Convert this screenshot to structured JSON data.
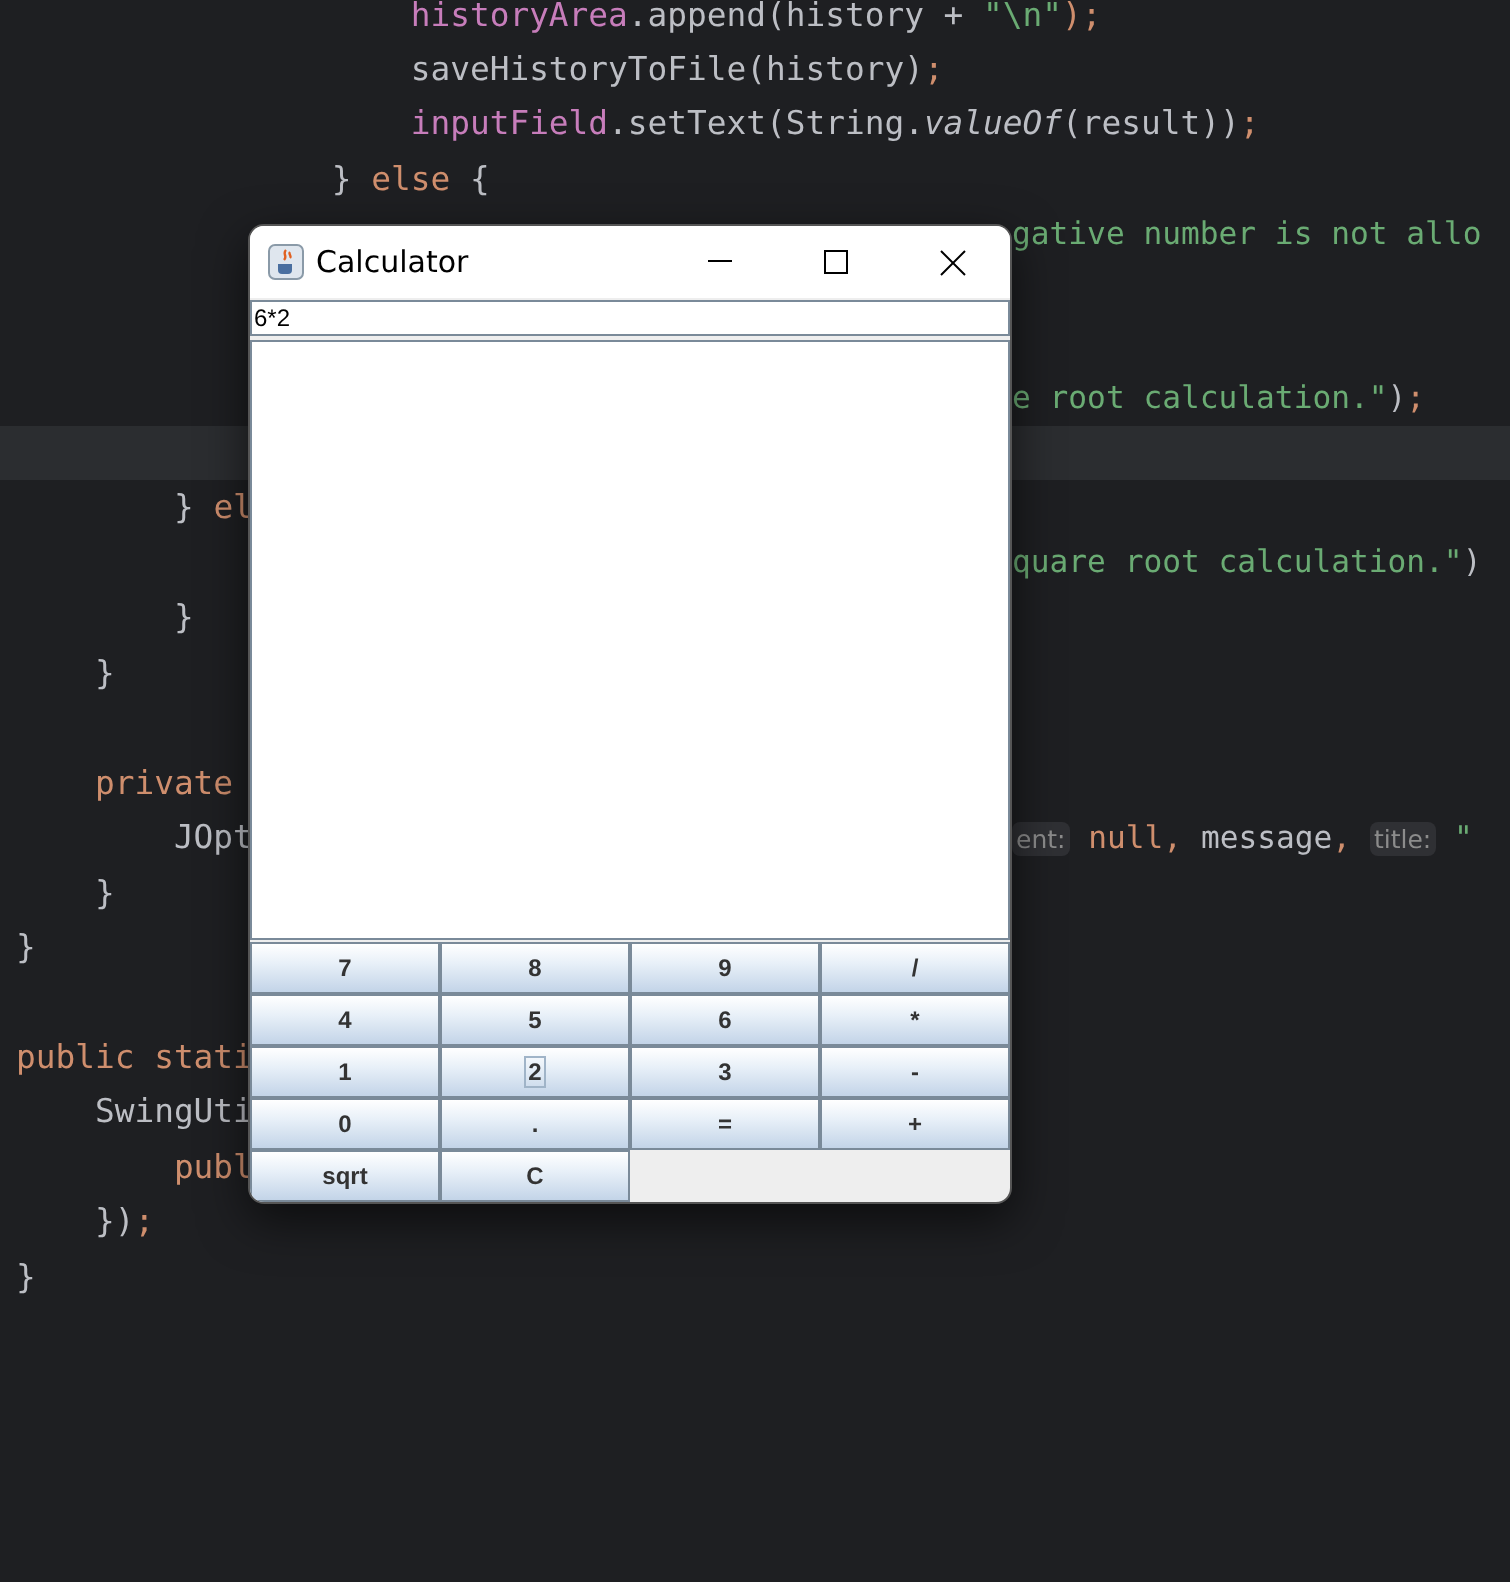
{
  "editor": {
    "lines": [
      {
        "current": false,
        "left": [
          {
            "text": "                    historyArea",
            "kind": "field"
          },
          {
            "text": ".append(history + ",
            "kind": "plain"
          },
          {
            "text": "\"\\n\"",
            "kind": "string"
          },
          {
            "text": ");",
            "kind": "keyword"
          }
        ]
      },
      {
        "current": false,
        "left": [
          {
            "text": "                    saveHistoryToFile(history)",
            "kind": "plain"
          },
          {
            "text": ";",
            "kind": "keyword"
          }
        ]
      },
      {
        "current": false,
        "left": [
          {
            "text": "                    inputField",
            "kind": "field"
          },
          {
            "text": ".setText(String.",
            "kind": "plain"
          },
          {
            "text": "valueOf",
            "kind": "static"
          },
          {
            "text": "(result))",
            "kind": "plain"
          },
          {
            "text": ";",
            "kind": "keyword"
          }
        ]
      },
      {
        "current": false,
        "left": [
          {
            "text": "                } ",
            "kind": "plain"
          },
          {
            "text": "else",
            "kind": "keyword"
          },
          {
            "text": " {",
            "kind": "plain"
          }
        ]
      },
      {
        "current": false,
        "right": [
          {
            "text": "gative number is not allo",
            "kind": "string"
          }
        ]
      },
      {
        "current": false
      },
      {
        "current": false
      },
      {
        "current": false,
        "right": [
          {
            "text": "e root calculation.\"",
            "kind": "string"
          },
          {
            "text": ")",
            "kind": "plain"
          },
          {
            "text": ";",
            "kind": "keyword"
          }
        ]
      },
      {
        "current": true
      },
      {
        "current": false,
        "left": [
          {
            "text": "        } ",
            "kind": "plain"
          },
          {
            "text": "el",
            "kind": "keyword"
          }
        ]
      },
      {
        "current": false,
        "right": [
          {
            "text": "quare root calculation.\"",
            "kind": "string"
          },
          {
            "text": ")",
            "kind": "plain"
          }
        ]
      },
      {
        "current": false,
        "left": [
          {
            "text": "        }",
            "kind": "plain"
          }
        ]
      },
      {
        "current": false,
        "left": [
          {
            "text": "    }",
            "kind": "plain"
          }
        ]
      },
      {
        "current": false
      },
      {
        "current": false,
        "left": [
          {
            "text": "    private",
            "kind": "keyword"
          }
        ]
      },
      {
        "current": false,
        "left": [
          {
            "text": "        JOpt",
            "kind": "plain"
          }
        ],
        "right": [
          {
            "text": "ent:",
            "kind": "hint"
          },
          {
            "text": " null, ",
            "kind": "keyword"
          },
          {
            "text": "message",
            "kind": "plain"
          },
          {
            "text": ", ",
            "kind": "keyword"
          },
          {
            "text": "title:",
            "kind": "hint"
          },
          {
            "text": " \"",
            "kind": "string"
          }
        ]
      },
      {
        "current": false,
        "left": [
          {
            "text": "    }",
            "kind": "plain"
          }
        ]
      },
      {
        "current": false,
        "left": [
          {
            "text": "}",
            "kind": "plain"
          }
        ]
      },
      {
        "current": false
      },
      {
        "current": false,
        "left": [
          {
            "text": "public stati",
            "kind": "keyword"
          }
        ]
      },
      {
        "current": false,
        "left": [
          {
            "text": "    SwingUti",
            "kind": "plain"
          }
        ]
      },
      {
        "current": false,
        "left": [
          {
            "text": "        publ",
            "kind": "keyword"
          }
        ]
      },
      {
        "current": false,
        "left": [
          {
            "text": "    })",
            "kind": "plain"
          },
          {
            "text": ";",
            "kind": "keyword"
          }
        ]
      },
      {
        "current": false,
        "left": [
          {
            "text": "}",
            "kind": "plain"
          }
        ]
      }
    ]
  },
  "window": {
    "title": "Calculator",
    "input": {
      "value": "6*2"
    },
    "buttons": [
      {
        "label": "7",
        "focused": false
      },
      {
        "label": "8",
        "focused": false
      },
      {
        "label": "9",
        "focused": false
      },
      {
        "label": "/",
        "focused": false
      },
      {
        "label": "4",
        "focused": false
      },
      {
        "label": "5",
        "focused": false
      },
      {
        "label": "6",
        "focused": false
      },
      {
        "label": "*",
        "focused": false
      },
      {
        "label": "1",
        "focused": false
      },
      {
        "label": "2",
        "focused": true
      },
      {
        "label": "3",
        "focused": false
      },
      {
        "label": "-",
        "focused": false
      },
      {
        "label": "0",
        "focused": false
      },
      {
        "label": ".",
        "focused": false
      },
      {
        "label": "=",
        "focused": false
      },
      {
        "label": "+",
        "focused": false
      },
      {
        "label": "sqrt",
        "focused": false
      },
      {
        "label": "C",
        "focused": false
      }
    ]
  }
}
